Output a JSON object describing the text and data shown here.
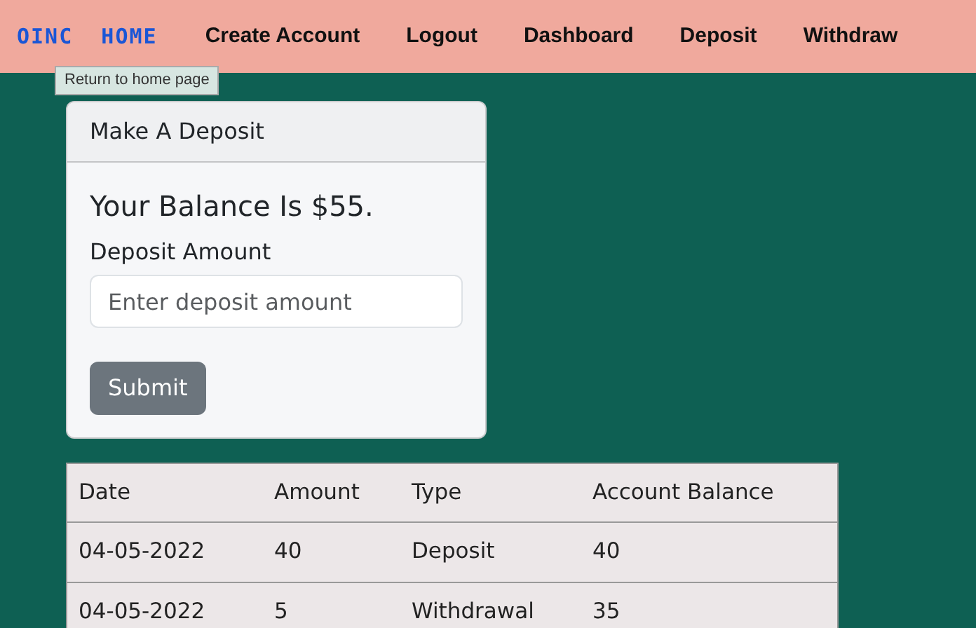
{
  "navbar": {
    "brand": "OINC  HOME",
    "links": [
      "Create Account",
      "Logout",
      "Dashboard",
      "Deposit",
      "Withdraw"
    ],
    "tooltip": "Return to home page"
  },
  "deposit_card": {
    "header": "Make A Deposit",
    "balance": "Your Balance Is $55.",
    "field_label": "Deposit Amount",
    "placeholder": "Enter deposit amount",
    "button": "Submit"
  },
  "table": {
    "columns": [
      "Date",
      "Amount",
      "Type",
      "Account Balance"
    ],
    "rows": [
      [
        "04-05-2022",
        "40",
        "Deposit",
        "40"
      ],
      [
        "04-05-2022",
        "5",
        "Withdrawal",
        "35"
      ]
    ]
  }
}
